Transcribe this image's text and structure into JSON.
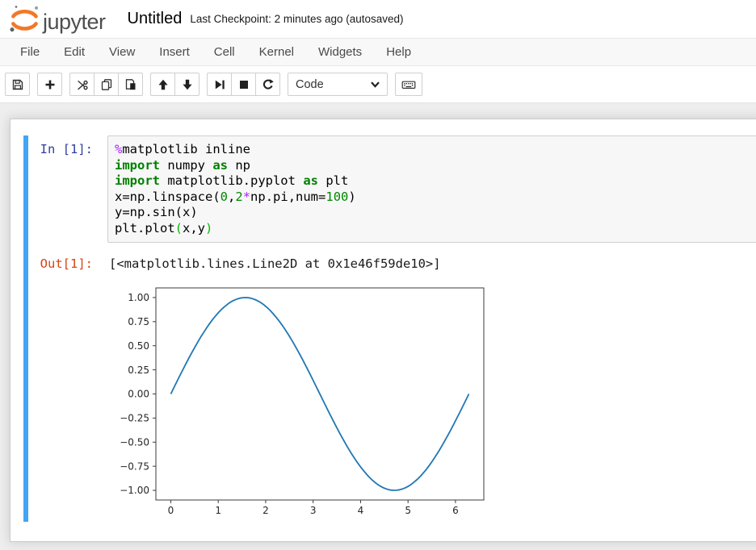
{
  "header": {
    "logo_text": "jupyter",
    "title": "Untitled",
    "checkpoint": "Last Checkpoint: 2 minutes ago (autosaved)"
  },
  "menu": {
    "items": [
      "File",
      "Edit",
      "View",
      "Insert",
      "Cell",
      "Kernel",
      "Widgets",
      "Help"
    ]
  },
  "toolbar": {
    "buttons": [
      "save-notebook",
      "insert-cell-below",
      "cut-cells",
      "copy-cells",
      "paste-cells",
      "move-cell-up",
      "move-cell-down",
      "run-cell",
      "interrupt-kernel",
      "restart-kernel",
      "open-command-palette"
    ],
    "cell_type_selected": "Code"
  },
  "cell": {
    "in_prompt": "In [1]:",
    "out_prompt": "Out[1]:",
    "code_lines": [
      [
        [
          "%",
          "op"
        ],
        [
          "matplotlib inline",
          ""
        ]
      ],
      [
        [
          "import",
          "kw"
        ],
        [
          " numpy ",
          ""
        ],
        [
          "as",
          "kw"
        ],
        [
          " np",
          ""
        ]
      ],
      [
        [
          "import",
          "kw"
        ],
        [
          " matplotlib.pyplot ",
          ""
        ],
        [
          "as",
          "kw"
        ],
        [
          " plt",
          ""
        ]
      ],
      [
        [
          "x=np.linspace(",
          ""
        ],
        [
          "0",
          "num"
        ],
        [
          ",",
          ""
        ],
        [
          "2",
          "num"
        ],
        [
          "*",
          "op"
        ],
        [
          "np.pi,num=",
          ""
        ],
        [
          "100",
          "num"
        ],
        [
          ")",
          ""
        ]
      ],
      [
        [
          "y=np.sin(x)",
          ""
        ]
      ],
      [
        [
          "plt.plot",
          ""
        ],
        [
          "(",
          "bracket"
        ],
        [
          "x,y",
          ""
        ],
        [
          ")",
          "bracket"
        ]
      ]
    ],
    "output_text": "[<matplotlib.lines.Line2D at 0x1e46f59de10>]"
  },
  "colors": {
    "selected_cell_accent": "#42a5f5",
    "prompt_in": "#303f9f",
    "prompt_out": "#d84315",
    "keyword": "#008000",
    "number": "#008800",
    "operator": "#aa22ff",
    "matching_bracket": "#00bb00",
    "logo_orange": "#f37726",
    "plot_line": "#1f77b4"
  },
  "chart_data": {
    "type": "line",
    "title": "",
    "xlabel": "",
    "ylabel": "",
    "series": [
      {
        "name": "sin(x)",
        "fn": "sin",
        "x_min": 0,
        "x_max": 6.283185307,
        "num_points": 100
      }
    ],
    "xlim": [
      -0.3141592,
      6.5973445
    ],
    "ylim": [
      -1.1,
      1.1
    ],
    "x_ticks": [
      0,
      1,
      2,
      3,
      4,
      5,
      6
    ],
    "y_ticks": [
      -1.0,
      -0.75,
      -0.5,
      -0.25,
      0.0,
      0.25,
      0.5,
      0.75,
      1.0
    ],
    "grid": false,
    "legend": null,
    "line_color": "#1f77b4",
    "line_width": 1.8
  }
}
